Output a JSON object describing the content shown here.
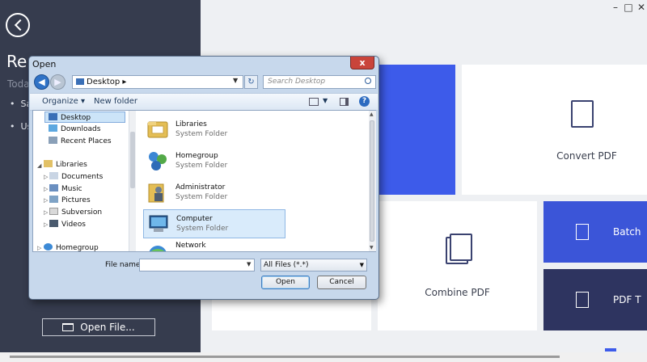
{
  "sidebar": {
    "title": "Re",
    "subtitle": "Toda",
    "bullets": [
      "Sa",
      "Us"
    ],
    "open_file_label": "Open File..."
  },
  "window_controls": {
    "minimize": "–",
    "maximize": "□",
    "close": "✕"
  },
  "tiles": {
    "convert_pdf": "Convert PDF",
    "combine_pdf": "Combine PDF",
    "batch": "Batch",
    "pdf_t": "PDF T"
  },
  "dialog": {
    "title": "Open",
    "close_label": "x",
    "address": "Desktop",
    "search_placeholder": "Search Desktop",
    "toolbar": {
      "organize": "Organize ▾",
      "new_folder": "New folder"
    },
    "nav_items": [
      {
        "label": "Desktop",
        "icon": "desktop-icon"
      },
      {
        "label": "Downloads",
        "icon": "downloads-icon"
      },
      {
        "label": "Recent Places",
        "icon": "recent-places-icon"
      },
      {
        "label": "Libraries",
        "icon": "libraries-icon"
      },
      {
        "label": "Documents",
        "icon": "documents-icon"
      },
      {
        "label": "Music",
        "icon": "music-icon"
      },
      {
        "label": "Pictures",
        "icon": "pictures-icon"
      },
      {
        "label": "Subversion",
        "icon": "subversion-icon"
      },
      {
        "label": "Videos",
        "icon": "videos-icon"
      },
      {
        "label": "Homegroup",
        "icon": "homegroup-icon"
      }
    ],
    "files": [
      {
        "name": "Libraries",
        "type": "System Folder",
        "icon": "libraries-folder-icon"
      },
      {
        "name": "Homegroup",
        "type": "System Folder",
        "icon": "homegroup-icon"
      },
      {
        "name": "Administrator",
        "type": "System Folder",
        "icon": "user-folder-icon"
      },
      {
        "name": "Computer",
        "type": "System Folder",
        "icon": "computer-icon"
      },
      {
        "name": "Network",
        "type": "",
        "icon": "network-icon"
      }
    ],
    "file_name_label": "File name:",
    "file_name_value": "",
    "filter": "All Files (*.*)",
    "open_label": "Open",
    "cancel_label": "Cancel"
  },
  "colors": {
    "sidebar_bg": "#363c4e",
    "accent_blue": "#3d5bea",
    "dark_navy": "#2e3460"
  }
}
